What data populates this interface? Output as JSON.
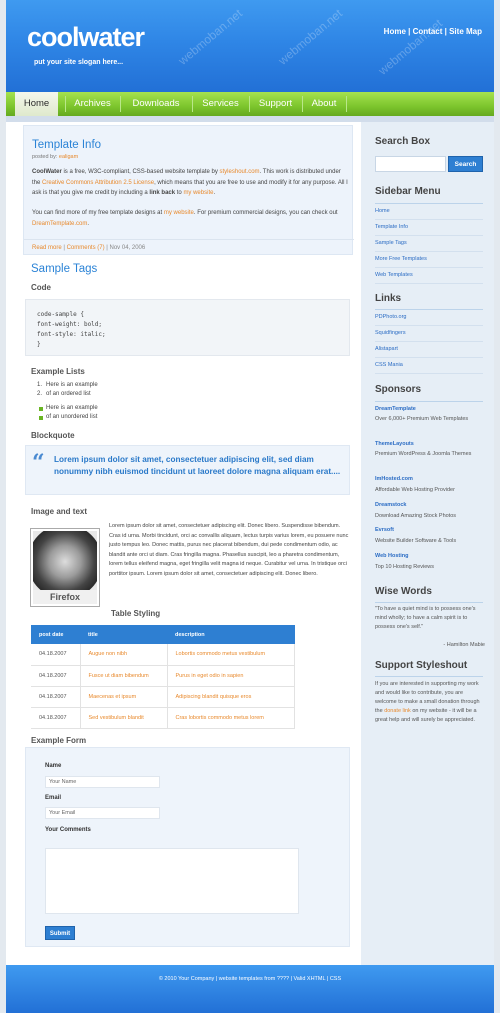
{
  "header": {
    "logo": "coolwater",
    "slogan": "put your site slogan here...",
    "toplinks": [
      "Home",
      "Contact",
      "Site Map"
    ],
    "watermark": "webmoban.net"
  },
  "nav": [
    "Home",
    "Archives",
    "Downloads",
    "Services",
    "Support",
    "About"
  ],
  "template_info": {
    "title": "Template Info",
    "posted_by_label": "posted by:",
    "posted_by": "ealigam",
    "para1_brand": "CoolWater",
    "para1_a": " is a free, W3C-compliant, CSS-based website template by ",
    "para1_link1": "styleshout.com",
    "para1_b": ". This work is distributed under the ",
    "para1_link2": "Creative Commons Attribution 2.5 License",
    "para1_c": ", which means that you are free to use and modify it for any purpose. All I ask is that you give me credit by including a ",
    "para1_bold": "link back",
    "para1_d": " to ",
    "para1_link3": "my website",
    "para1_e": ".",
    "para2_a": "You can find more of my free template designs at ",
    "para2_link1": "my website",
    "para2_b": ". For premium commercial designs, you can check out ",
    "para2_link2": "DreamTemplate.com",
    "para2_c": ".",
    "read_more": "Read more",
    "comments": "Comments (7)",
    "date": "Nov 04, 2006"
  },
  "sample_tags": {
    "title": "Sample Tags",
    "code_heading": "Code",
    "code_lines": [
      "code-sample {",
      "font-weight: bold;",
      "font-style: italic;",
      "}"
    ],
    "lists_heading": "Example Lists",
    "ordered": [
      "Here is an example",
      "of an ordered list"
    ],
    "unordered": [
      "Here is an example",
      "of an unordered list"
    ],
    "blockquote_heading": "Blockquote",
    "quote": "Lorem ipsum dolor sit amet, consectetuer adipiscing elit, sed diam nonummy nibh euismod tincidunt ut laoreet dolore magna aliquam erat....",
    "image_heading": "Image and text",
    "image_caption": "Firefox",
    "image_text": "Lorem ipsum dolor sit amet, consectetuer adipiscing elit. Donec libero. Suspendisse bibendum. Cras id urna. Morbi tincidunt, orci ac convallis aliquam, lectus turpis varius lorem, eu posuere nunc justo tempus leo. Donec mattis, purus nec placerat bibendum, dui pede condimentum odio, ac blandit ante orci ut diam. Cras fringilla magna. Phasellus suscipit, leo a pharetra condimentum, lorem tellus eleifend magna, eget fringilla velit magna id neque. Curabitur vel urna. In tristique orci porttitor ipsum. Lorem ipsum dolor sit amet, consectetuer adipiscing elit. Donec libero.",
    "table_heading": "Table Styling",
    "table_headers": [
      "post date",
      "title",
      "description"
    ],
    "table_rows": [
      [
        "04.18.2007",
        "Augue non nibh",
        "Lobortis commodo metus vestibulum"
      ],
      [
        "04.18.2007",
        "Fusce ut diam bibendum",
        "Purus in eget odio in sapien"
      ],
      [
        "04.18.2007",
        "Maecenas et ipsum",
        "Adipiscing blandit quisque eros"
      ],
      [
        "04.18.2007",
        "Sed vestibulum blandit",
        "Cras lobortis commodo metus lorem"
      ]
    ],
    "form_heading": "Example Form",
    "form_name_label": "Name",
    "form_name_value": "Your Name",
    "form_email_label": "Email",
    "form_email_value": "Your Email",
    "form_comments_label": "Your Comments",
    "form_submit": "Submit"
  },
  "sidebar": {
    "search_title": "Search Box",
    "search_button": "Search",
    "menu_title": "Sidebar Menu",
    "menu": [
      "Home",
      "Template Info",
      "Sample Tags",
      "More Free Templates",
      "Web Templates"
    ],
    "links_title": "Links",
    "links": [
      "PDPhoto.org",
      "Squidfingers",
      "Alistapart",
      "CSS Mania"
    ],
    "sponsors_title": "Sponsors",
    "sponsors": [
      {
        "name": "DreamTemplate",
        "desc": "Over 6,000+ Premium Web Templates"
      },
      {
        "name": "ThemeLayouts",
        "desc": "Premium WordPress & Joomla Themes"
      },
      {
        "name": "ImHosted.com",
        "desc": "Affordable Web Hosting Provider"
      },
      {
        "name": "Dreamstock",
        "desc": "Download Amazing Stock Photos"
      },
      {
        "name": "Evrsoft",
        "desc": "Website Builder Software & Tools"
      },
      {
        "name": "Web Hosting",
        "desc": "Top 10 Hosting Reviews"
      }
    ],
    "wise_title": "Wise Words",
    "wise_quote": "\"To have a quiet mind is to possess one's mind wholly; to have a calm spirit is to possess one's self.\"",
    "wise_author": "- Hamilton Mabie",
    "support_title": "Support Styleshout",
    "support_a": "If you are interested in supporting my work and would like to contribute, you are welcome to make a small donation through the ",
    "support_link": "donate link",
    "support_b": " on my website - it will be a great help and will surely be appreciated."
  },
  "footer": {
    "text": "© 2010 Your Company | website templates from ???? | Valid XHTML | CSS"
  },
  "colors": {
    "header_blue": "#2f86e6",
    "nav_green": "#7cc52d",
    "link_orange": "#e8892c",
    "heading_blue": "#2b83d6"
  }
}
